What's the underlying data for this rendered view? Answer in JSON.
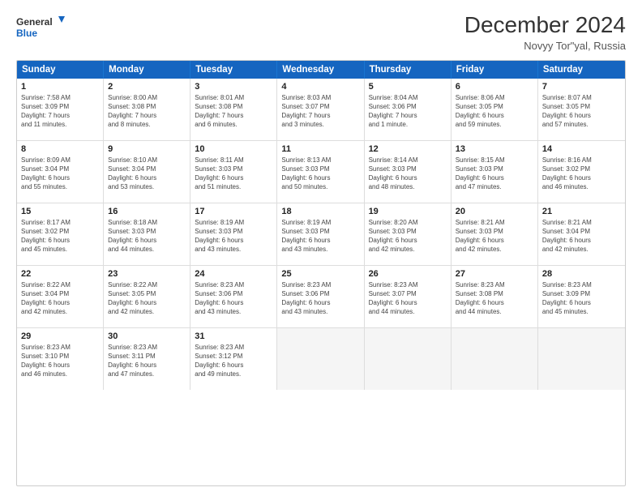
{
  "header": {
    "logo_line1": "General",
    "logo_line2": "Blue",
    "title": "December 2024",
    "subtitle": "Novyy Tor\"yal, Russia"
  },
  "weekdays": [
    "Sunday",
    "Monday",
    "Tuesday",
    "Wednesday",
    "Thursday",
    "Friday",
    "Saturday"
  ],
  "weeks": [
    [
      {
        "day": "1",
        "info": "Sunrise: 7:58 AM\nSunset: 3:09 PM\nDaylight: 7 hours\nand 11 minutes."
      },
      {
        "day": "2",
        "info": "Sunrise: 8:00 AM\nSunset: 3:08 PM\nDaylight: 7 hours\nand 8 minutes."
      },
      {
        "day": "3",
        "info": "Sunrise: 8:01 AM\nSunset: 3:08 PM\nDaylight: 7 hours\nand 6 minutes."
      },
      {
        "day": "4",
        "info": "Sunrise: 8:03 AM\nSunset: 3:07 PM\nDaylight: 7 hours\nand 3 minutes."
      },
      {
        "day": "5",
        "info": "Sunrise: 8:04 AM\nSunset: 3:06 PM\nDaylight: 7 hours\nand 1 minute."
      },
      {
        "day": "6",
        "info": "Sunrise: 8:06 AM\nSunset: 3:05 PM\nDaylight: 6 hours\nand 59 minutes."
      },
      {
        "day": "7",
        "info": "Sunrise: 8:07 AM\nSunset: 3:05 PM\nDaylight: 6 hours\nand 57 minutes."
      }
    ],
    [
      {
        "day": "8",
        "info": "Sunrise: 8:09 AM\nSunset: 3:04 PM\nDaylight: 6 hours\nand 55 minutes."
      },
      {
        "day": "9",
        "info": "Sunrise: 8:10 AM\nSunset: 3:04 PM\nDaylight: 6 hours\nand 53 minutes."
      },
      {
        "day": "10",
        "info": "Sunrise: 8:11 AM\nSunset: 3:03 PM\nDaylight: 6 hours\nand 51 minutes."
      },
      {
        "day": "11",
        "info": "Sunrise: 8:13 AM\nSunset: 3:03 PM\nDaylight: 6 hours\nand 50 minutes."
      },
      {
        "day": "12",
        "info": "Sunrise: 8:14 AM\nSunset: 3:03 PM\nDaylight: 6 hours\nand 48 minutes."
      },
      {
        "day": "13",
        "info": "Sunrise: 8:15 AM\nSunset: 3:03 PM\nDaylight: 6 hours\nand 47 minutes."
      },
      {
        "day": "14",
        "info": "Sunrise: 8:16 AM\nSunset: 3:02 PM\nDaylight: 6 hours\nand 46 minutes."
      }
    ],
    [
      {
        "day": "15",
        "info": "Sunrise: 8:17 AM\nSunset: 3:02 PM\nDaylight: 6 hours\nand 45 minutes."
      },
      {
        "day": "16",
        "info": "Sunrise: 8:18 AM\nSunset: 3:03 PM\nDaylight: 6 hours\nand 44 minutes."
      },
      {
        "day": "17",
        "info": "Sunrise: 8:19 AM\nSunset: 3:03 PM\nDaylight: 6 hours\nand 43 minutes."
      },
      {
        "day": "18",
        "info": "Sunrise: 8:19 AM\nSunset: 3:03 PM\nDaylight: 6 hours\nand 43 minutes."
      },
      {
        "day": "19",
        "info": "Sunrise: 8:20 AM\nSunset: 3:03 PM\nDaylight: 6 hours\nand 42 minutes."
      },
      {
        "day": "20",
        "info": "Sunrise: 8:21 AM\nSunset: 3:03 PM\nDaylight: 6 hours\nand 42 minutes."
      },
      {
        "day": "21",
        "info": "Sunrise: 8:21 AM\nSunset: 3:04 PM\nDaylight: 6 hours\nand 42 minutes."
      }
    ],
    [
      {
        "day": "22",
        "info": "Sunrise: 8:22 AM\nSunset: 3:04 PM\nDaylight: 6 hours\nand 42 minutes."
      },
      {
        "day": "23",
        "info": "Sunrise: 8:22 AM\nSunset: 3:05 PM\nDaylight: 6 hours\nand 42 minutes."
      },
      {
        "day": "24",
        "info": "Sunrise: 8:23 AM\nSunset: 3:06 PM\nDaylight: 6 hours\nand 43 minutes."
      },
      {
        "day": "25",
        "info": "Sunrise: 8:23 AM\nSunset: 3:06 PM\nDaylight: 6 hours\nand 43 minutes."
      },
      {
        "day": "26",
        "info": "Sunrise: 8:23 AM\nSunset: 3:07 PM\nDaylight: 6 hours\nand 44 minutes."
      },
      {
        "day": "27",
        "info": "Sunrise: 8:23 AM\nSunset: 3:08 PM\nDaylight: 6 hours\nand 44 minutes."
      },
      {
        "day": "28",
        "info": "Sunrise: 8:23 AM\nSunset: 3:09 PM\nDaylight: 6 hours\nand 45 minutes."
      }
    ],
    [
      {
        "day": "29",
        "info": "Sunrise: 8:23 AM\nSunset: 3:10 PM\nDaylight: 6 hours\nand 46 minutes."
      },
      {
        "day": "30",
        "info": "Sunrise: 8:23 AM\nSunset: 3:11 PM\nDaylight: 6 hours\nand 47 minutes."
      },
      {
        "day": "31",
        "info": "Sunrise: 8:23 AM\nSunset: 3:12 PM\nDaylight: 6 hours\nand 49 minutes."
      },
      {
        "day": "",
        "info": ""
      },
      {
        "day": "",
        "info": ""
      },
      {
        "day": "",
        "info": ""
      },
      {
        "day": "",
        "info": ""
      }
    ]
  ]
}
